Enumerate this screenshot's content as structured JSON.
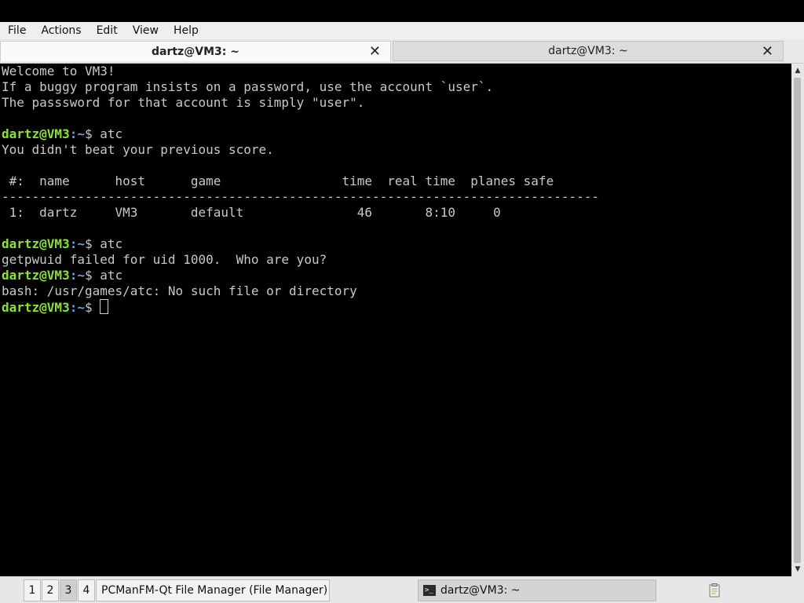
{
  "menubar": {
    "items": [
      "File",
      "Actions",
      "Edit",
      "View",
      "Help"
    ]
  },
  "tabs": [
    {
      "label": "dartz@VM3: ~",
      "close": "✕",
      "active": true
    },
    {
      "label": "dartz@VM3: ~",
      "close": "✕",
      "active": false
    }
  ],
  "terminal": {
    "lines": [
      {
        "text": "Welcome to VM3!"
      },
      {
        "text": "If a buggy program insists on a password, use the account `user`."
      },
      {
        "text": "The passsword for that account is simply \"user\"."
      },
      {
        "text": ""
      },
      {
        "prompt": true,
        "cmd": " atc"
      },
      {
        "text": "You didn't beat your previous score."
      },
      {
        "text": ""
      },
      {
        "text": " #:  name      host      game                time  real time  planes safe"
      },
      {
        "text": "-------------------------------------------------------------------------------"
      },
      {
        "text": " 1:  dartz     VM3       default               46       8:10     0"
      },
      {
        "text": ""
      },
      {
        "prompt": true,
        "cmd": " atc"
      },
      {
        "text": "getpwuid failed for uid 1000.  Who are you?"
      },
      {
        "prompt": true,
        "cmd": " atc"
      },
      {
        "text": "bash: /usr/games/atc: No such file or directory"
      },
      {
        "prompt": true,
        "cmd": " ",
        "cursor": true
      }
    ],
    "prompt_user": "dartz@VM3",
    "prompt_sep": ":",
    "prompt_path": "~",
    "prompt_dollar": "$"
  },
  "taskbar": {
    "desktops": [
      "1",
      "2",
      "3",
      "4"
    ],
    "active_desktop": "3",
    "tasks": [
      {
        "label": "PCManFM-Qt File Manager (File Manager)"
      },
      {
        "label": "dartz@VM3: ~",
        "icon": "terminal-icon"
      }
    ],
    "tray": {
      "icon": "clipboard-icon"
    }
  },
  "colors": {
    "prompt_user": "#8ae234",
    "prompt_path": "#729fcf",
    "terminal_bg": "#000000",
    "terminal_fg": "#c8c8c8"
  }
}
